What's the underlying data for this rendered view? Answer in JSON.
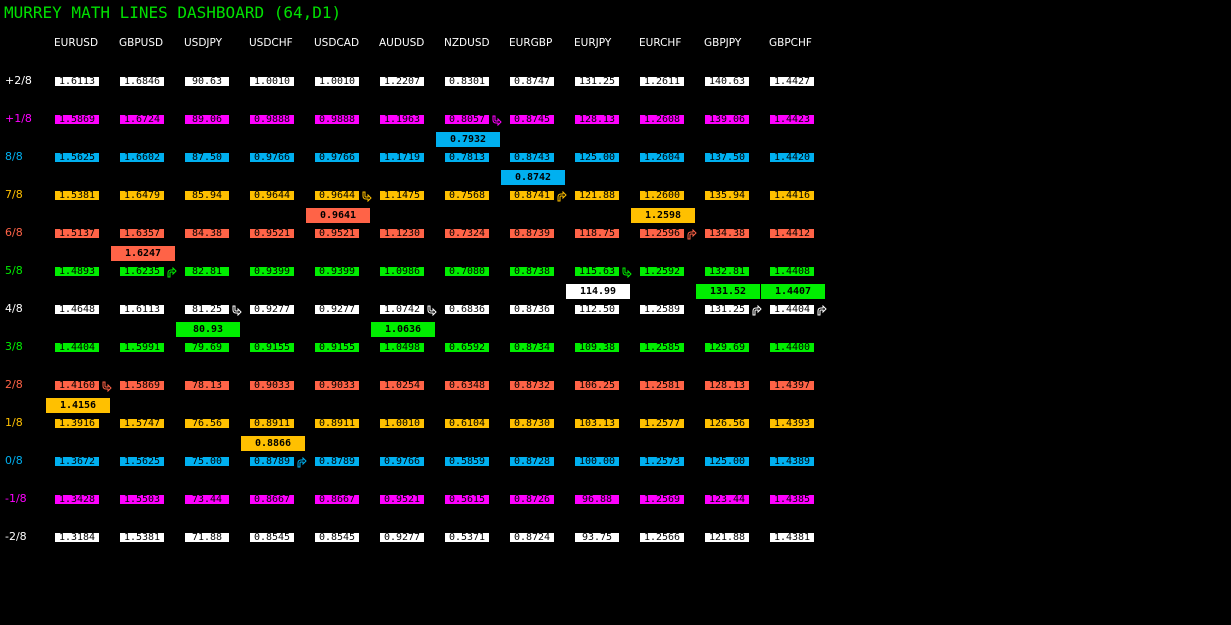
{
  "title": "MURREY MATH LINES DASHBOARD (64,D1)",
  "colors": {
    "white": "#ffffff",
    "magenta": "#ff00ff",
    "blue": "#00b0f0",
    "gold": "#ffc000",
    "red": "#ff6347",
    "green": "#00ee00"
  },
  "symbols": [
    "EURUSD",
    "GBPUSD",
    "USDJPY",
    "USDCHF",
    "USDCAD",
    "AUDUSD",
    "NZDUSD",
    "EURGBP",
    "EURJPY",
    "EURCHF",
    "GBPJPY",
    "GBPCHF"
  ],
  "levels": [
    {
      "label": "+2/8",
      "color": "white",
      "values": [
        "1.6113",
        "1.6846",
        "90.63",
        "1.0010",
        "1.0010",
        "1.2207",
        "0.8301",
        "0.8747",
        "131.25",
        "1.2611",
        "140.63",
        "1.4427"
      ]
    },
    {
      "label": "+1/8",
      "color": "magenta",
      "values": [
        "1.5869",
        "1.6724",
        "89.06",
        "0.9888",
        "0.9888",
        "1.1963",
        "0.8057",
        "0.8745",
        "128.13",
        "1.2608",
        "139.06",
        "1.4423"
      ]
    },
    {
      "label": "8/8",
      "color": "blue",
      "values": [
        "1.5625",
        "1.6602",
        "87.50",
        "0.9766",
        "0.9766",
        "1.1719",
        "0.7813",
        "0.8743",
        "125.00",
        "1.2604",
        "137.50",
        "1.4420"
      ]
    },
    {
      "label": "7/8",
      "color": "gold",
      "values": [
        "1.5381",
        "1.6479",
        "85.94",
        "0.9644",
        "0.9644",
        "1.1475",
        "0.7568",
        "0.8741",
        "121.88",
        "1.2600",
        "135.94",
        "1.4416"
      ]
    },
    {
      "label": "6/8",
      "color": "red",
      "values": [
        "1.5137",
        "1.6357",
        "84.38",
        "0.9521",
        "0.9521",
        "1.1230",
        "0.7324",
        "0.8739",
        "118.75",
        "1.2596",
        "134.38",
        "1.4412"
      ]
    },
    {
      "label": "5/8",
      "color": "green",
      "values": [
        "1.4893",
        "1.6235",
        "82.81",
        "0.9399",
        "0.9399",
        "1.0986",
        "0.7080",
        "0.8738",
        "115.63",
        "1.2592",
        "132.81",
        "1.4408"
      ]
    },
    {
      "label": "4/8",
      "color": "white",
      "values": [
        "1.4648",
        "1.6113",
        "81.25",
        "0.9277",
        "0.9277",
        "1.0742",
        "0.6836",
        "0.8736",
        "112.50",
        "1.2589",
        "131.25",
        "1.4404"
      ]
    },
    {
      "label": "3/8",
      "color": "green",
      "values": [
        "1.4404",
        "1.5991",
        "79.69",
        "0.9155",
        "0.9155",
        "1.0498",
        "0.6592",
        "0.8734",
        "109.38",
        "1.2585",
        "129.69",
        "1.4400"
      ]
    },
    {
      "label": "2/8",
      "color": "red",
      "values": [
        "1.4160",
        "1.5869",
        "78.13",
        "0.9033",
        "0.9033",
        "1.0254",
        "0.6348",
        "0.8732",
        "106.25",
        "1.2581",
        "128.13",
        "1.4397"
      ]
    },
    {
      "label": "1/8",
      "color": "gold",
      "values": [
        "1.3916",
        "1.5747",
        "76.56",
        "0.8911",
        "0.8911",
        "1.0010",
        "0.6104",
        "0.8730",
        "103.13",
        "1.2577",
        "126.56",
        "1.4393"
      ]
    },
    {
      "label": "0/8",
      "color": "blue",
      "values": [
        "1.3672",
        "1.5625",
        "75.00",
        "0.8789",
        "0.8789",
        "0.9766",
        "0.5859",
        "0.8728",
        "100.00",
        "1.2573",
        "125.00",
        "1.4389"
      ]
    },
    {
      "label": "-1/8",
      "color": "magenta",
      "values": [
        "1.3428",
        "1.5503",
        "73.44",
        "0.8667",
        "0.8667",
        "0.9521",
        "0.5615",
        "0.8726",
        "96.88",
        "1.2569",
        "123.44",
        "1.4385"
      ]
    },
    {
      "label": "-2/8",
      "color": "white",
      "values": [
        "1.3184",
        "1.5381",
        "71.88",
        "0.8545",
        "0.8545",
        "0.9277",
        "0.5371",
        "0.8724",
        "93.75",
        "1.2566",
        "121.88",
        "1.4381"
      ]
    }
  ],
  "current_prices": [
    {
      "symbol": "EURUSD",
      "value": "1.4156",
      "below_level": 8,
      "color": "gold",
      "arrow_on_level": 8,
      "arrow": "down"
    },
    {
      "symbol": "GBPUSD",
      "value": "1.6247",
      "below_level": 4,
      "color": "red",
      "arrow_on_level": 5,
      "arrow": "up"
    },
    {
      "symbol": "USDJPY",
      "value": "80.93",
      "below_level": 6,
      "color": "green",
      "arrow_on_level": 6,
      "arrow": "down"
    },
    {
      "symbol": "USDCHF",
      "value": "0.8866",
      "below_level": 9,
      "color": "gold",
      "arrow_on_level": 10,
      "arrow": "up"
    },
    {
      "symbol": "USDCAD",
      "value": "0.9641",
      "below_level": 3,
      "color": "red",
      "arrow_on_level": 3,
      "arrow": "down"
    },
    {
      "symbol": "AUDUSD",
      "value": "1.0636",
      "below_level": 6,
      "color": "green",
      "arrow_on_level": 6,
      "arrow": "down"
    },
    {
      "symbol": "NZDUSD",
      "value": "0.7932",
      "below_level": 1,
      "color": "blue",
      "arrow_on_level": 1,
      "arrow": "down"
    },
    {
      "symbol": "EURGBP",
      "value": "0.8742",
      "below_level": 2,
      "color": "blue",
      "arrow_on_level": 3,
      "arrow": "up"
    },
    {
      "symbol": "EURJPY",
      "value": "114.99",
      "below_level": 5,
      "color": "white",
      "arrow_on_level": 5,
      "arrow": "down"
    },
    {
      "symbol": "EURCHF",
      "value": "1.2598",
      "below_level": 3,
      "color": "gold",
      "arrow_on_level": 4,
      "arrow": "up"
    },
    {
      "symbol": "GBPJPY",
      "value": "131.52",
      "below_level": 5,
      "color": "green",
      "arrow_on_level": 6,
      "arrow": "up"
    },
    {
      "symbol": "GBPCHF",
      "value": "1.4407",
      "below_level": 5,
      "color": "green",
      "arrow_on_level": 6,
      "arrow": "up"
    }
  ]
}
